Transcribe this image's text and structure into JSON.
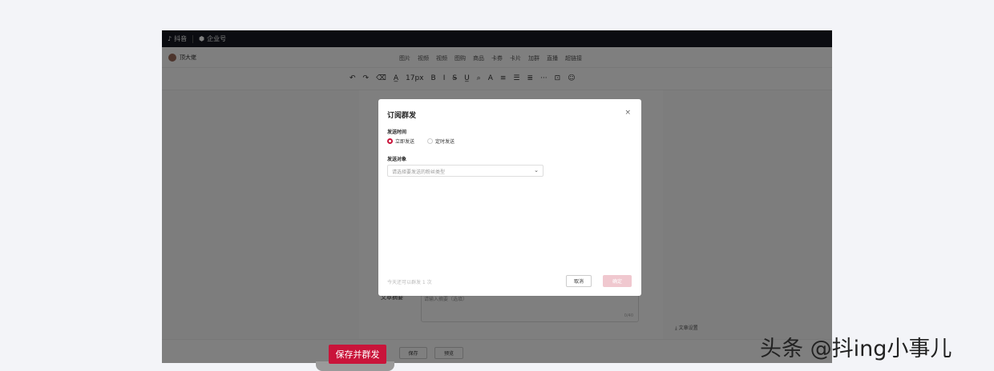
{
  "topbar": {
    "brand": "抖音",
    "product": "企业号"
  },
  "toolbar1": {
    "user": "顶大佬",
    "media": [
      "图片",
      "视频",
      "视频",
      "图购",
      "商品",
      "卡券",
      "卡片",
      "加群",
      "直播",
      "超链接"
    ]
  },
  "toolbar2": {
    "items": [
      "↶",
      "↷",
      "⌫",
      "A̲",
      "17px",
      "B",
      "I",
      "S̶",
      "U̲",
      "⌕",
      "A",
      "≡",
      "☰",
      "≣",
      "···",
      "⊡",
      "☺"
    ]
  },
  "editor": {
    "abstract_label": "文章摘要",
    "abstract_placeholder": "请输入摘要（选填）",
    "abstract_count": "0/40",
    "doc_settings": "文章设置"
  },
  "bottom": {
    "publish": "保存并群发",
    "save": "保存",
    "preview": "预览"
  },
  "modal": {
    "title": "订阅群发",
    "close": "×",
    "send_time_label": "发送时间",
    "send_now": "立即发送",
    "send_scheduled": "定时发送",
    "target_label": "发送对象",
    "target_placeholder": "请选择要发送的粉丝类型",
    "quota": "今天还可以群发 1 次",
    "cancel": "取消",
    "ok": "确定"
  },
  "watermark": "头条 @抖ing小事儿",
  "colors": {
    "accent": "#c9143a",
    "topbar": "#161823"
  }
}
